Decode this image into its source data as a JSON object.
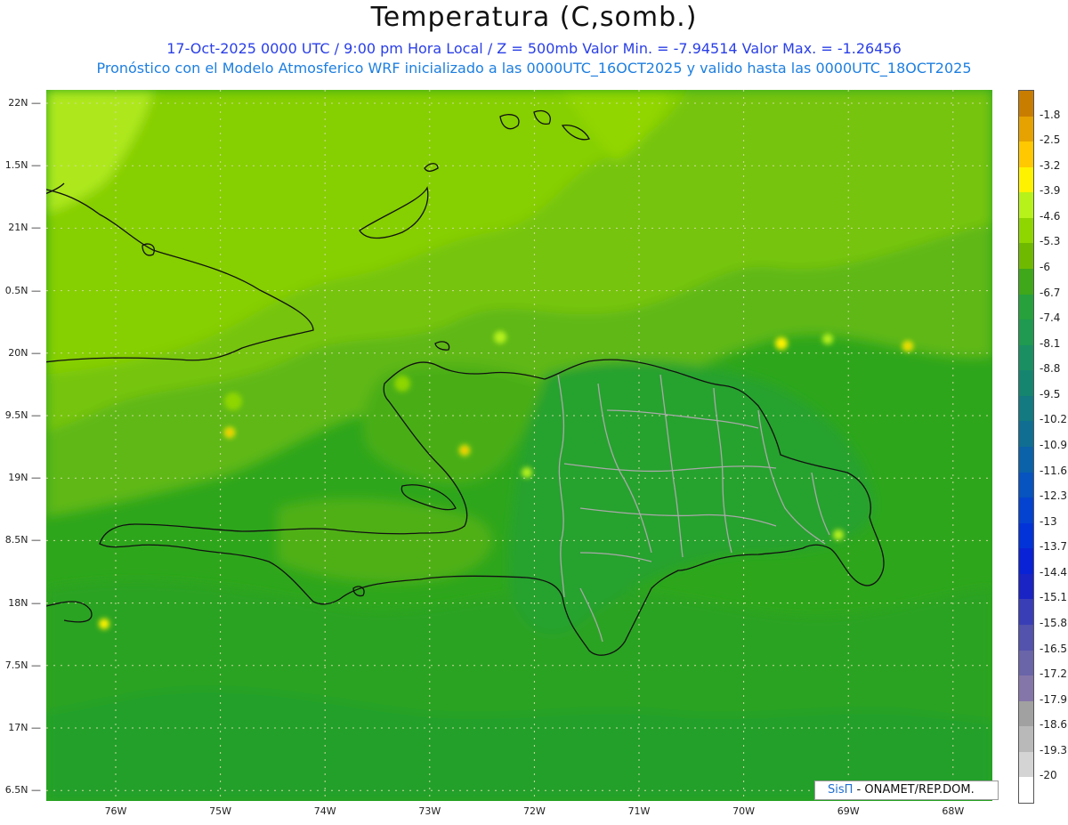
{
  "title": "Temperatura (C,somb.)",
  "subtitle_line1": "17-Oct-2025  0000 UTC / 9:00 pm Hora Local / Z = 500mb  Valor Min. = -7.94514  Valor Max. = -1.26456",
  "subtitle_line2": "Pronóstico con el Modelo Atmosferico WRF inicializado a las 0000UTC_16OCT2025 y valido hasta las  0000UTC_18OCT2025",
  "map": {
    "lat_labels": [
      "22N",
      "1.5N",
      "21N",
      "0.5N",
      "20N",
      "9.5N",
      "19N",
      "8.5N",
      "18N",
      "7.5N",
      "17N",
      "6.5N"
    ],
    "lon_labels": [
      "76W",
      "75W",
      "74W",
      "73W",
      "72W",
      "71W",
      "70W",
      "69W",
      "68W"
    ],
    "grid": true,
    "grid_color": "#cfd8a0"
  },
  "colorbar": {
    "labels": [
      "-1.8",
      "-2.5",
      "-3.2",
      "-3.9",
      "-4.6",
      "-5.3",
      "-6",
      "-6.7",
      "-7.4",
      "-8.1",
      "-8.8",
      "-9.5",
      "-10.2",
      "-10.9",
      "-11.6",
      "-12.3",
      "-13",
      "-13.7",
      "-14.4",
      "-15.1",
      "-15.8",
      "-16.5",
      "-17.2",
      "-17.9",
      "-18.6",
      "-19.3",
      "-20"
    ],
    "colors": [
      "#c97d00",
      "#e6a200",
      "#ffc800",
      "#fff200",
      "#b7f21a",
      "#8fd600",
      "#6fba00",
      "#3fa81a",
      "#26a13c",
      "#1f9a50",
      "#1a8f62",
      "#168570",
      "#127a80",
      "#0f6e92",
      "#0b62a8",
      "#0753bf",
      "#0443cf",
      "#0233d8",
      "#0a22d6",
      "#1a24c4",
      "#3a3eb6",
      "#5352ac",
      "#6a64a9",
      "#8576a9",
      "#a1a1a1",
      "#b9b9b9",
      "#d4d4d4",
      "#ffffff"
    ]
  },
  "credit": {
    "brand": "SisΠ",
    "text": " - ONAMET/REP.DOM."
  }
}
